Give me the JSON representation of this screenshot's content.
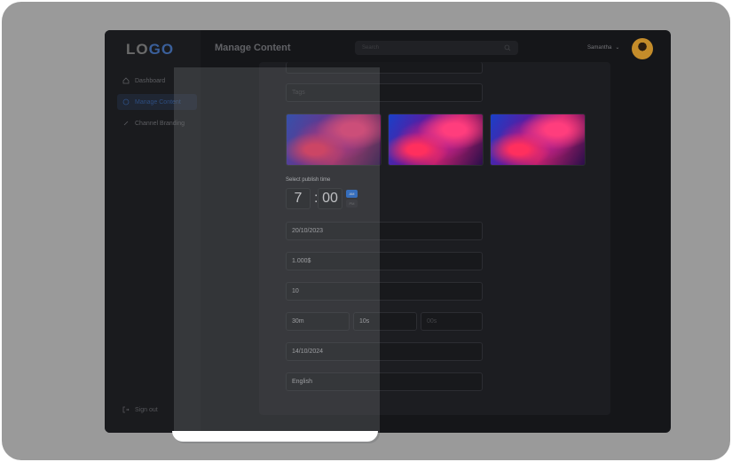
{
  "brand": {
    "logo_left": "LO",
    "logo_right": "GO"
  },
  "header": {
    "title": "Manage Content",
    "search_placeholder": "Search",
    "user_name": "Samantha"
  },
  "sidebar": {
    "items": [
      {
        "label": "Dashboard"
      },
      {
        "label": "Manage Content"
      },
      {
        "label": "Channel Branding"
      }
    ],
    "signout": "Sign out"
  },
  "form": {
    "tags_placeholder": "Tags",
    "publish_label": "Select publish time",
    "hour": "7",
    "minute": "00",
    "am": "AM",
    "pm": "PM",
    "date": "20/10/2023",
    "price": "1.000$",
    "quantity": "10",
    "duration": [
      "30m",
      "10s",
      "00s"
    ],
    "end_date": "14/10/2024",
    "language": "English"
  },
  "colors": {
    "accent": "#1a6de4"
  }
}
